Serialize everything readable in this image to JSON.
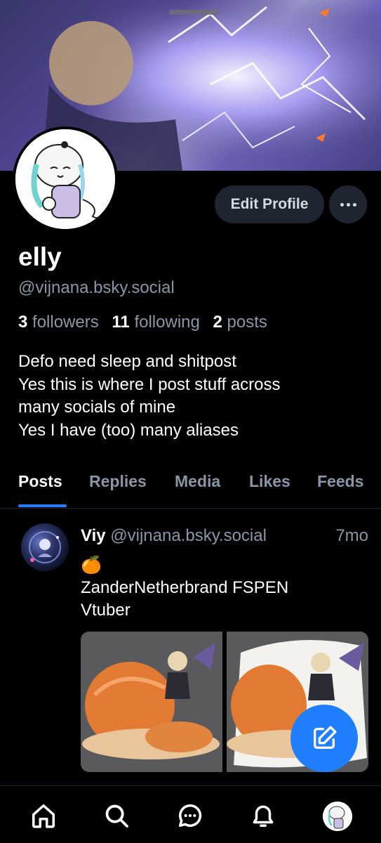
{
  "profile": {
    "name": "elly",
    "handle": "@vijnana.bsky.social",
    "followers_count": "3",
    "followers_label": "followers",
    "following_count": "11",
    "following_label": "following",
    "posts_count": "2",
    "posts_label": "posts",
    "bio_lines": [
      "Defo need sleep and shitpost",
      "Yes this is where I post stuff across",
      "many socials of mine",
      "Yes I have (too) many aliases"
    ]
  },
  "actions": {
    "edit_profile_label": "Edit Profile",
    "more_icon": "ellipsis-icon"
  },
  "tabs": [
    {
      "label": "Posts",
      "active": true
    },
    {
      "label": "Replies",
      "active": false
    },
    {
      "label": "Media",
      "active": false
    },
    {
      "label": "Likes",
      "active": false
    },
    {
      "label": "Feeds",
      "active": false
    }
  ],
  "post": {
    "author": "Viy",
    "handle": "@vijnana.bsky.social",
    "time": "7mo",
    "emoji": "🍊",
    "text_lines": [
      "ZanderNetherbrand FSPEN",
      "Vtuber"
    ],
    "image_count": 2
  },
  "nav": {
    "items": [
      "home-icon",
      "search-icon",
      "chat-icon",
      "notifications-icon",
      "profile-avatar"
    ]
  },
  "colors": {
    "accent": "#1f7fff",
    "muted_text": "#8a96a6",
    "button_bg": "#1e2530",
    "background": "#000000"
  }
}
